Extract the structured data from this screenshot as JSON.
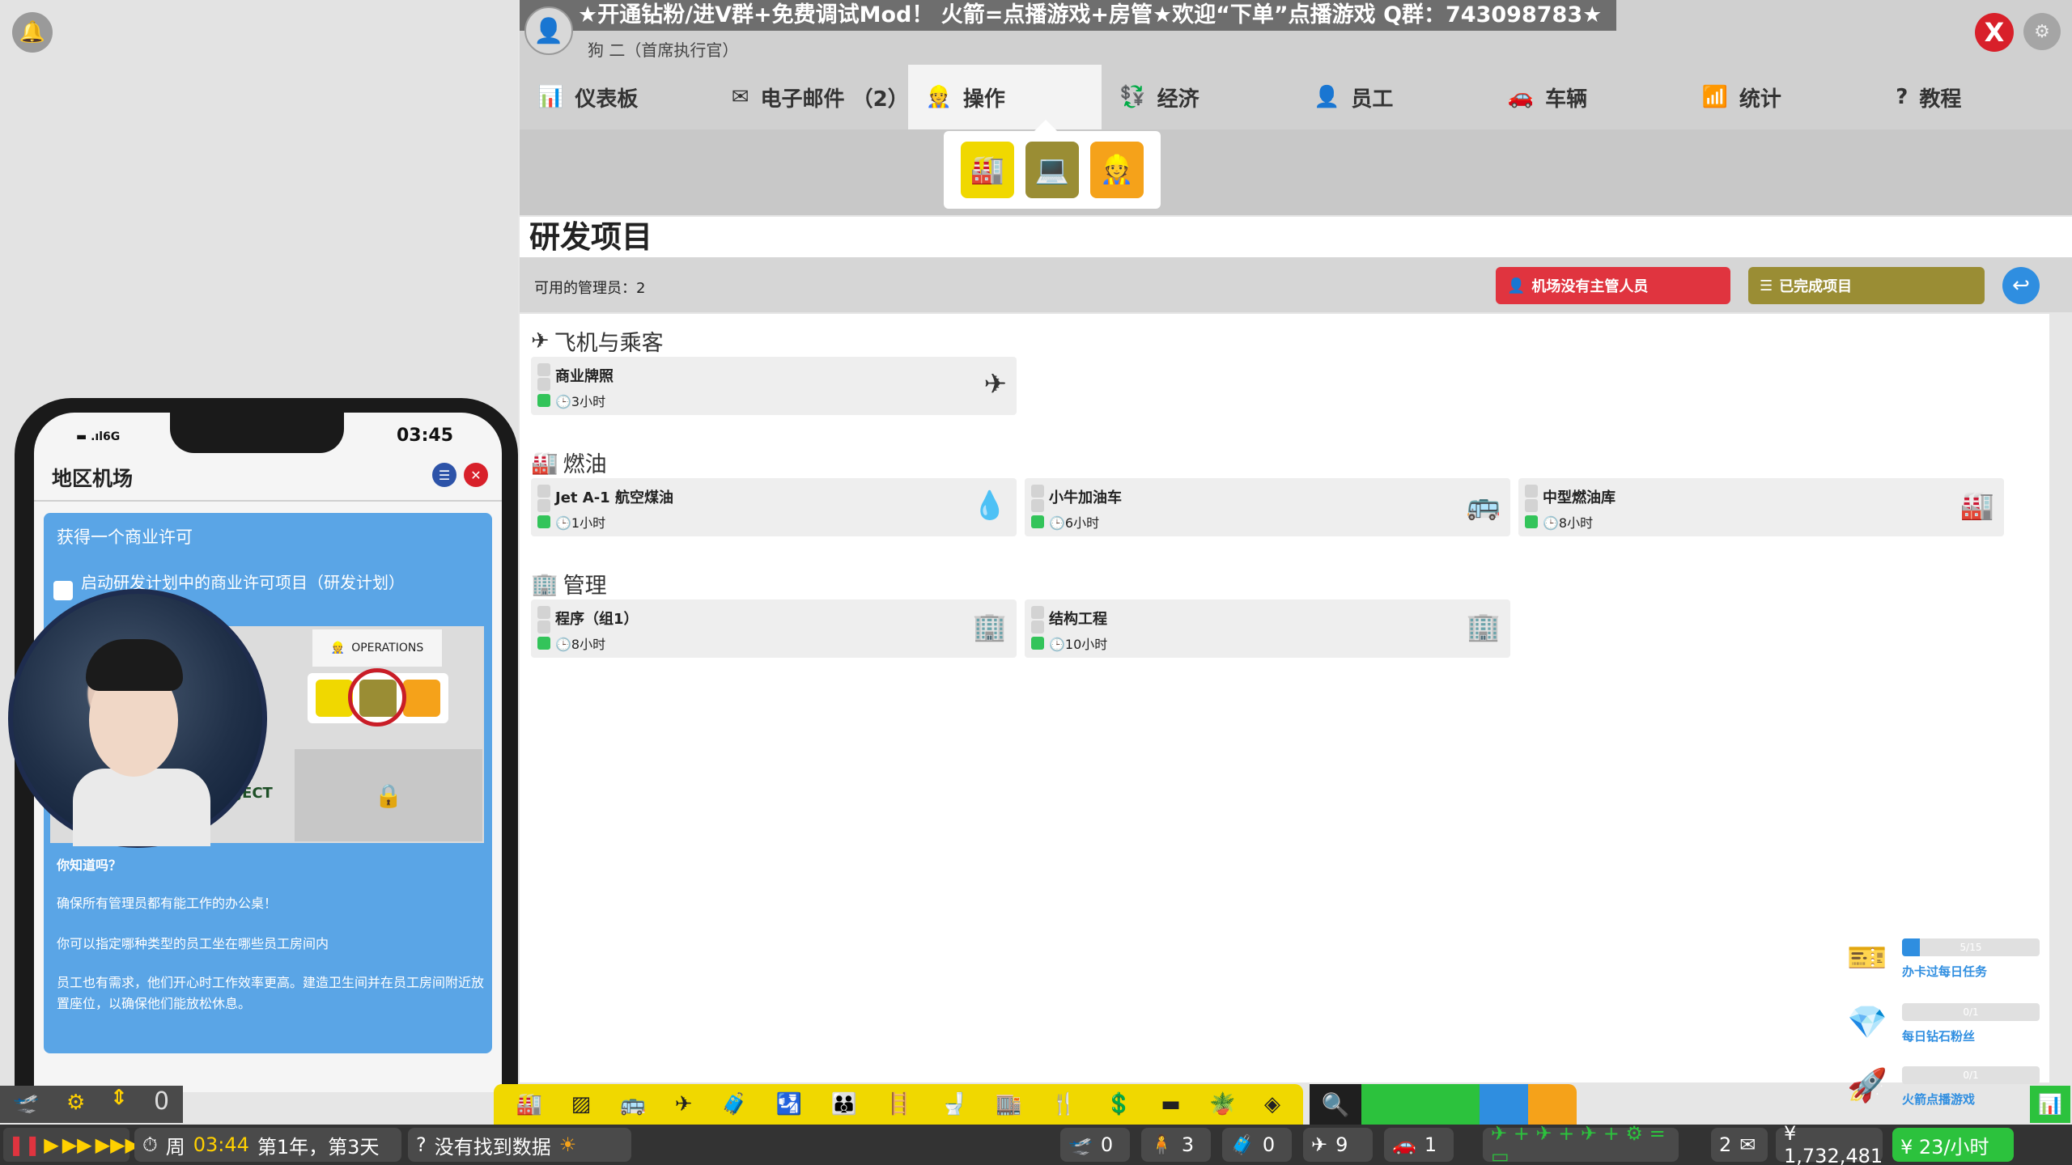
{
  "top": {
    "banner": "★开通钻粉/进V群+免费调试Mod！ 火箭=点播游戏+房管★欢迎“下单”点播游戏 Q群：743098783★",
    "ceo_title": "狗 二（首席执行官）",
    "close_label": "X",
    "settings_label": "⚙"
  },
  "tabs": [
    {
      "label": "仪表板",
      "icon": "bar-chart-icon"
    },
    {
      "label": "电子邮件 （2）",
      "icon": "mail-icon"
    },
    {
      "label": "操作",
      "icon": "operator-icon",
      "active": true
    },
    {
      "label": "经济",
      "icon": "economy-icon"
    },
    {
      "label": "员工",
      "icon": "staff-icon"
    },
    {
      "label": "车辆",
      "icon": "car-icon"
    },
    {
      "label": "统计",
      "icon": "stats-icon"
    },
    {
      "label": "教程",
      "icon": "help-icon"
    }
  ],
  "main": {
    "title": "研发项目",
    "managers": "可用的管理员：2",
    "no_manager_btn": "机场没有主管人员",
    "completed_btn": "已完成项目"
  },
  "sections": [
    {
      "title": "飞机与乘客",
      "cards": [
        {
          "name": "商业牌照",
          "time": "3小时"
        }
      ]
    },
    {
      "title": "燃油",
      "cards": [
        {
          "name": "Jet A-1 航空煤油",
          "time": "1小时"
        },
        {
          "name": "小牛加油车",
          "time": "6小时"
        },
        {
          "name": "中型燃油库",
          "time": "8小时"
        }
      ]
    },
    {
      "title": "管理",
      "cards": [
        {
          "name": "程序（组1）",
          "time": "8小时"
        },
        {
          "name": "结构工程",
          "time": "10小时"
        }
      ]
    }
  ],
  "phone": {
    "signal": "6G",
    "clock": "03:45",
    "title": "地区机场",
    "heading": "获得一个商业许可",
    "task": "启动研发计划中的商业许可项目（研发计划）",
    "shot_tab": "OPERATIONS",
    "shot_project": "PROJECT",
    "tip_title": "你知道吗？",
    "tips": [
      "确保所有管理员都有能工作的办公桌！",
      "你可以指定哪种类型的员工坐在哪些员工房间内",
      "员工也有需求，他们开心时工作效率更高。建造卫生间并在员工房间附近放置座位，以确保他们能放松休息。"
    ]
  },
  "bottom": {
    "left_zero": "0",
    "week": "周",
    "time": "03:44",
    "date": "第1年，第3天",
    "status": "没有找到数据",
    "counts": [
      "0",
      "3",
      "0",
      "9",
      "1"
    ],
    "mail_count": "2",
    "money": "¥ 1,732,481",
    "rate": "¥ 23/小时"
  },
  "missions": [
    {
      "progress": "5/15",
      "label": "办卡过每日任务",
      "fraction": 0.13
    },
    {
      "progress": "0/1",
      "label": "每日钻石粉丝",
      "fraction": 0
    },
    {
      "progress": "0/1",
      "label": "火箭点播游戏",
      "fraction": 0
    }
  ]
}
